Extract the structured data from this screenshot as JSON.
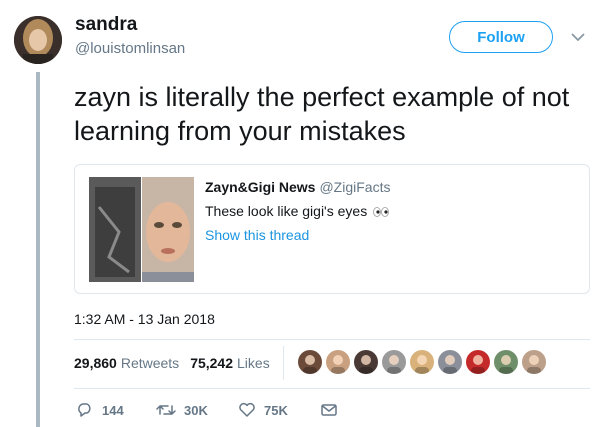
{
  "user": {
    "display_name": "sandra",
    "handle": "@louistomlinsan",
    "avatar": "profile-photo"
  },
  "follow_label": "Follow",
  "tweet_text": "zayn is literally the perfect example of not learning from your mistakes",
  "quoted": {
    "name": "Zayn&Gigi News",
    "handle": "@ZigiFacts",
    "text": "These look like gigi's eyes",
    "text_emoji": "eyes-emoji",
    "show_thread": "Show this thread"
  },
  "timestamp": "1:32 AM - 13 Jan 2018",
  "stats": {
    "retweets_count": "29,860",
    "retweets_label": "Retweets",
    "likes_count": "75,242",
    "likes_label": "Likes"
  },
  "likers": [
    "#6b4a3a",
    "#c9a080",
    "#4a3a35",
    "#9a9a9a",
    "#d8b27a",
    "#8a8f99",
    "#c42a2a",
    "#6f8f6a",
    "#bda08a"
  ],
  "actions": {
    "replies": "144",
    "retweets": "30K",
    "likes": "75K"
  },
  "colors": {
    "accent": "#1da1f2",
    "link": "#1b95e0",
    "muted": "#657786",
    "border": "#e1e8ed"
  }
}
